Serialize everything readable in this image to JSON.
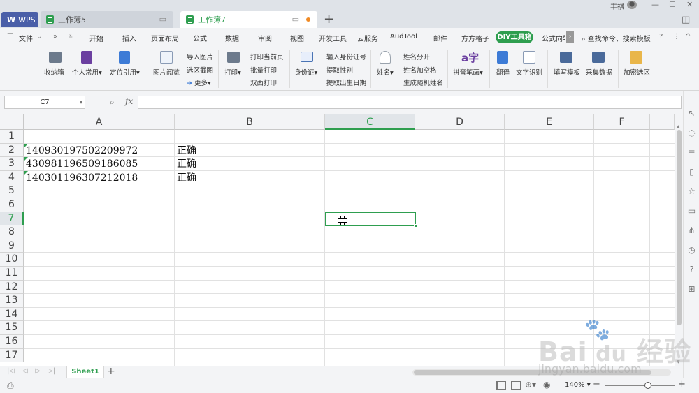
{
  "window": {
    "user_name": "丰祺",
    "tabs": [
      {
        "label": "WPS"
      },
      {
        "label": "工作簿5"
      },
      {
        "label": "工作簿7"
      }
    ]
  },
  "menu": {
    "file": "文件",
    "items": [
      "开始",
      "插入",
      "页面布局",
      "公式",
      "数据",
      "审阅",
      "视图",
      "开发工具",
      "云服务",
      "AudTool",
      "邮件",
      "方方格子",
      "DIY工具箱",
      "公式向导"
    ],
    "search": "查找命令、搜索模板"
  },
  "ribbon": {
    "shoujiao": "收纳箱",
    "geren": "个人常用",
    "dingwei": "定位引用",
    "tupian_view": "图片阅览",
    "import_pic": "导入图片",
    "region_shot": "选区截图",
    "more": "更多",
    "print": "打印",
    "print_current": "打印当前页",
    "batch_print": "批量打印",
    "duplex_print": "双面打印",
    "id_card": "身份证",
    "input_id": "输入身份证号",
    "get_gender": "提取性别",
    "get_birth": "提取出生日期",
    "name": "姓名",
    "name_split": "姓名分开",
    "name_space": "姓名加空格",
    "random_name": "生成随机姓名",
    "pinyin": "拼音笔画",
    "translate": "翻译",
    "ocr": "文字识别",
    "fill_template": "填写模板",
    "collect_data": "采集数据",
    "encrypt": "加密选区"
  },
  "formula_bar": {
    "name_box": "C7",
    "fx": "fx",
    "value": ""
  },
  "columns": [
    "A",
    "B",
    "C",
    "D",
    "E",
    "F"
  ],
  "active_column": "C",
  "active_row": "7",
  "rows": [
    "1",
    "2",
    "3",
    "4",
    "5",
    "6",
    "7",
    "8",
    "9",
    "10",
    "11",
    "12",
    "13",
    "14",
    "15",
    "16",
    "17"
  ],
  "cells": {
    "A2": "140930197502209972",
    "B2": "正确",
    "A3": "430981196509186085",
    "B3": "正确",
    "A4": "140301196307212018",
    "B4": "正确"
  },
  "sheets": {
    "active": "Sheet1"
  },
  "status": {
    "zoom": "140%"
  },
  "watermark": {
    "brand": "Bai",
    "brand2": "经验",
    "url": "jingyan.baidu.com"
  },
  "colors": {
    "accent": "#2e9e4f",
    "wps_tab": "#4a5fa8",
    "modified_dot": "#f08a24"
  }
}
